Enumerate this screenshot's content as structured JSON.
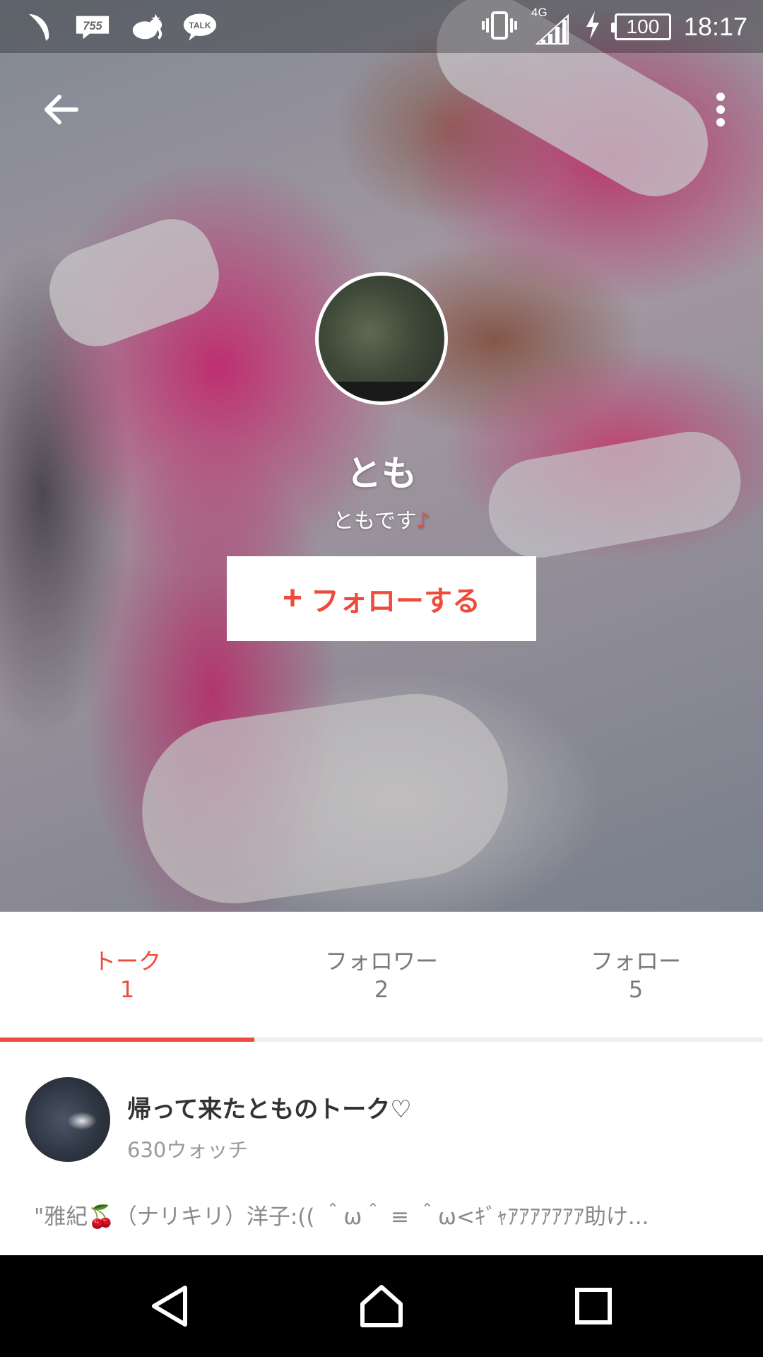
{
  "status_bar": {
    "time": "18:17",
    "battery": "100",
    "network": "4G",
    "left_icons": [
      "feather-icon",
      "755-app-icon",
      "elephant-app-icon",
      "talk-app-icon"
    ],
    "notification_labels": {
      "app_755": "755",
      "talk": "TALK"
    }
  },
  "toolbar": {
    "back_icon": "back-arrow-icon",
    "more_icon": "more-vert-icon"
  },
  "profile": {
    "name": "とも",
    "bio": "ともです",
    "bio_symbol": "♪",
    "follow_plus": "+",
    "follow_label": "フォローする"
  },
  "tabs": [
    {
      "label": "トーク",
      "count": "1",
      "active": true
    },
    {
      "label": "フォロワー",
      "count": "2",
      "active": false
    },
    {
      "label": "フォロー",
      "count": "5",
      "active": false
    }
  ],
  "talk": {
    "title": "帰って来たとものトーク♡",
    "watch": "630ウォッチ",
    "preview": "\"雅紀🍒（ナリキリ）洋子:(( ＾ω＾ ≡ ＾ω<ｷﾞｬｱｱｱｱｱｱｱ助け..."
  },
  "colors": {
    "accent": "#ee4b3a",
    "nav_bar": "#000000",
    "tab_inactive": "#7a7a7a"
  },
  "nav": [
    "back-triangle-icon",
    "home-icon",
    "recents-icon"
  ]
}
